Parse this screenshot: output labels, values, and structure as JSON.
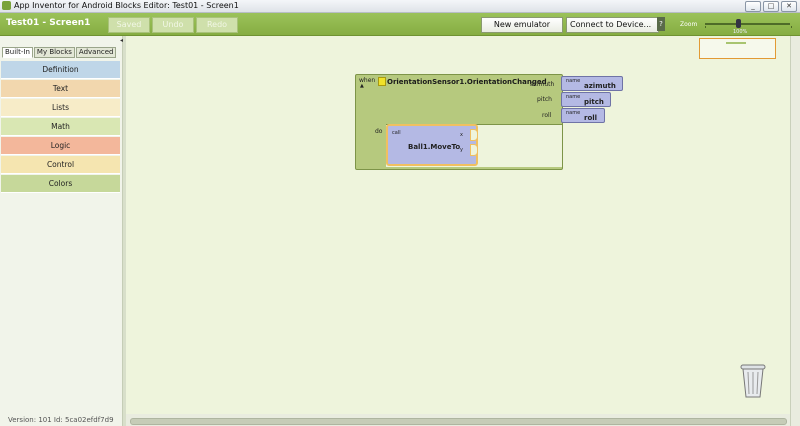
{
  "window": {
    "title": "App Inventor for Android Blocks Editor: Test01 - Screen1",
    "controls": [
      "_",
      "□",
      "✕"
    ]
  },
  "toolbar": {
    "project": "Test01 - Screen1",
    "saved": "Saved",
    "undo": "Undo",
    "redo": "Redo",
    "new_emulator": "New emulator",
    "connect": "Connect to Device...",
    "help": "?",
    "zoom_label": "Zoom",
    "zoom_value": "100%"
  },
  "sidebar": {
    "tabs": [
      "Built-In",
      "My Blocks",
      "Advanced"
    ],
    "categories": [
      {
        "label": "Definition",
        "color": "#bfd6e8"
      },
      {
        "label": "Text",
        "color": "#f2d7ae"
      },
      {
        "label": "Lists",
        "color": "#f7ecc8"
      },
      {
        "label": "Math",
        "color": "#d9e7b3"
      },
      {
        "label": "Logic",
        "color": "#f3b79b"
      },
      {
        "label": "Control",
        "color": "#f5e5b0"
      },
      {
        "label": "Colors",
        "color": "#c6d89a"
      }
    ],
    "version": "Version: 101 Id: 5ca02efdf7d9"
  },
  "event_block": {
    "when": "when",
    "title": "OrientationSensor1.OrientationChanged",
    "do": "do",
    "params": [
      {
        "label": "azimuth",
        "name_tag": "name",
        "value": "azimuth"
      },
      {
        "label": "pitch",
        "name_tag": "name",
        "value": "pitch"
      },
      {
        "label": "roll",
        "name_tag": "name",
        "value": "roll"
      }
    ]
  },
  "call_block": {
    "call": "call",
    "name": "Ball1.MoveTo",
    "x": "x",
    "y": "y"
  }
}
